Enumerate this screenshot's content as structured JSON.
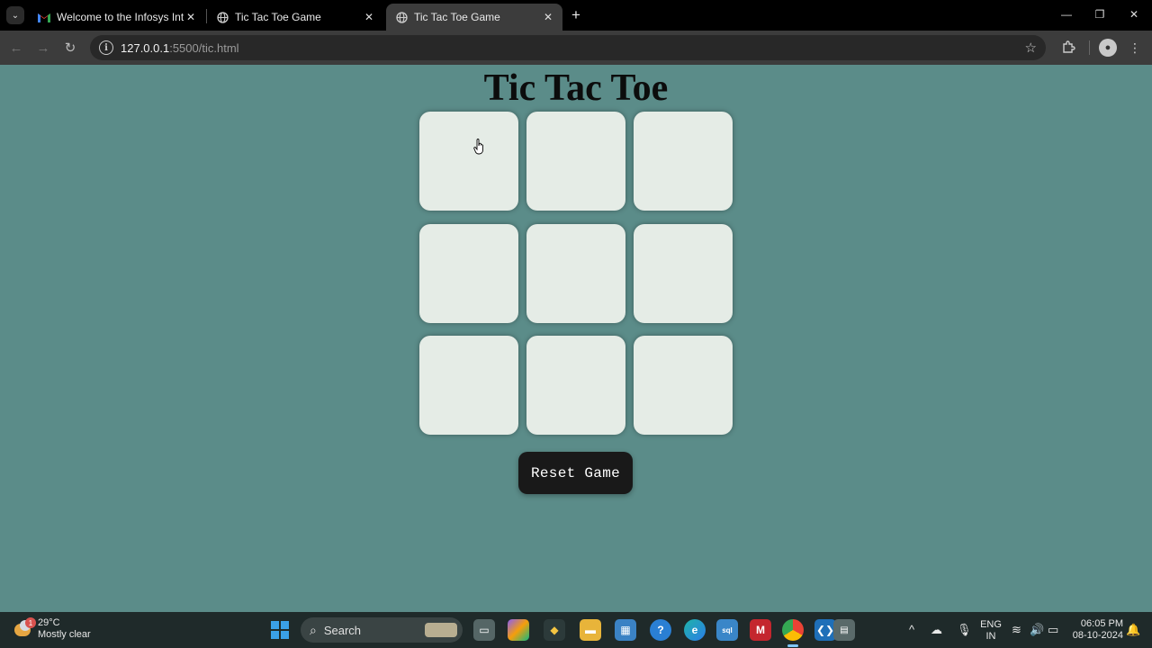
{
  "browser": {
    "tabs": [
      {
        "title": "Welcome to the Infosys Interns",
        "favicon": "gmail-icon"
      },
      {
        "title": "Tic Tac Toe Game",
        "favicon": "globe-icon"
      },
      {
        "title": "Tic Tac Toe Game",
        "favicon": "globe-icon",
        "active": true
      }
    ],
    "url_host": "127.0.0.1",
    "url_path": ":5500/tic.html"
  },
  "game": {
    "title": "Tic Tac Toe",
    "cells": [
      "",
      "",
      "",
      "",
      "",
      "",
      "",
      "",
      ""
    ],
    "reset_label": "Reset Game"
  },
  "taskbar": {
    "weather_temp": "29°C",
    "weather_desc": "Mostly clear",
    "weather_badge": "1",
    "search_label": "Search",
    "lang_top": "ENG",
    "lang_bottom": "IN",
    "time": "06:05 PM",
    "date": "08-10-2024"
  },
  "colors": {
    "page_background": "#5b8c89",
    "cell_background": "#e5ece6",
    "reset_background": "#191919",
    "title_color": "#0c0c0c"
  }
}
